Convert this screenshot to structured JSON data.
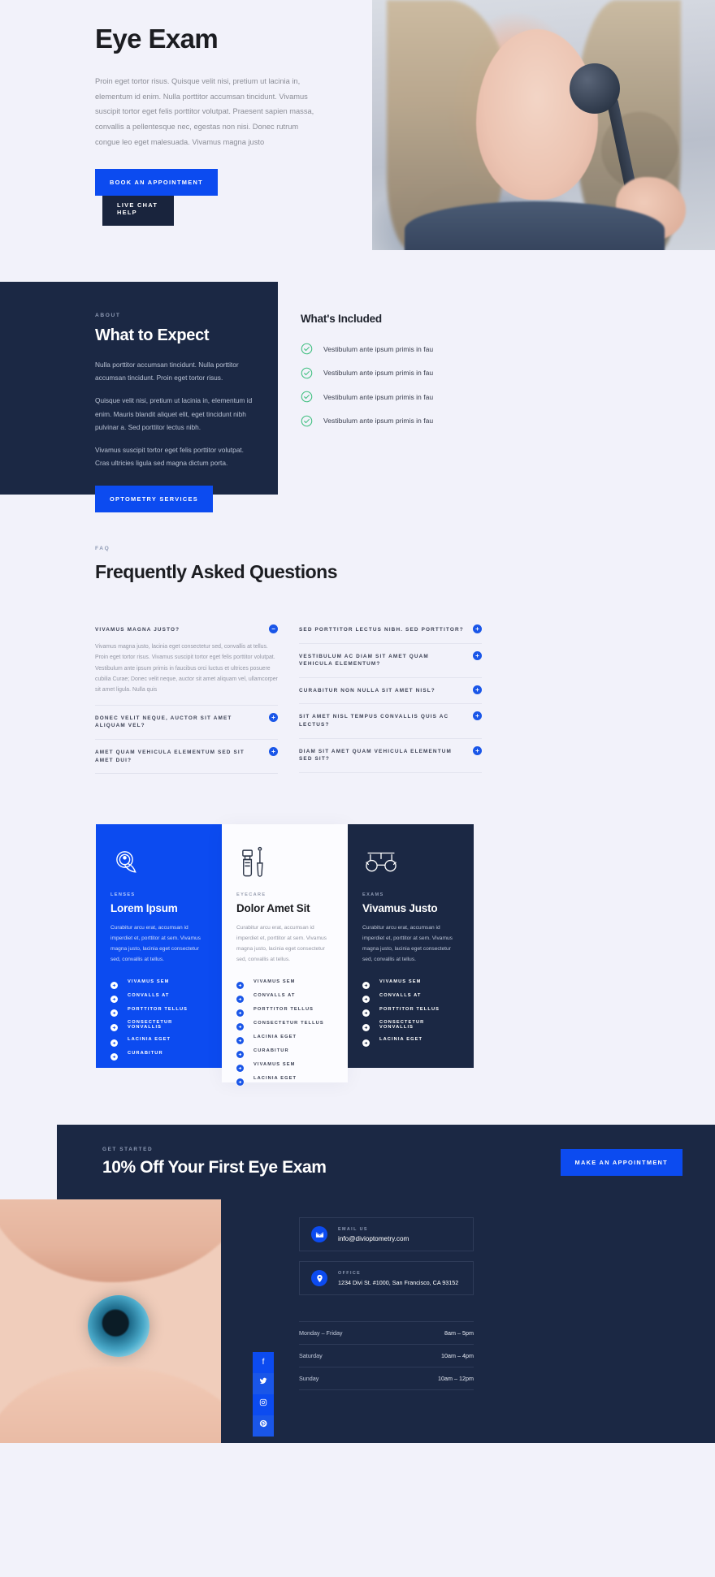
{
  "hero": {
    "title": "Eye Exam",
    "paragraph": "Proin eget tortor risus. Quisque velit nisi, pretium ut lacinia in, elementum id enim. Nulla porttitor accumsan tincidunt. Vivamus suscipit tortor eget felis porttitor volutpat. Praesent sapien massa, convallis a pellentesque nec, egestas non nisi. Donec rutrum congue leo eget malesuada. Vivamus magna justo",
    "primary_button": "BOOK AN APPOINTMENT",
    "secondary_button": "LIVE CHAT HELP"
  },
  "about": {
    "eyebrow": "ABOUT",
    "title": "What to Expect",
    "paragraphs": [
      "Nulla porttitor accumsan tincidunt. Nulla porttitor accumsan tincidunt. Proin eget tortor risus.",
      "Quisque velit nisi, pretium ut lacinia in, elementum id enim. Mauris blandit aliquet elit, eget tincidunt nibh pulvinar a. Sed porttitor lectus nibh.",
      "Vivamus suscipit tortor eget felis porttitor volutpat. Cras ultricies ligula sed magna dictum porta."
    ],
    "button": "OPTOMETRY SERVICES",
    "included_title": "What's Included",
    "included_items": [
      "Vestibulum ante ipsum primis in fau",
      "Vestibulum ante ipsum primis in fau",
      "Vestibulum ante ipsum primis in fau",
      "Vestibulum ante ipsum primis in fau"
    ],
    "check_color": "#3fbf7f"
  },
  "faq": {
    "eyebrow": "FAQ",
    "title": "Frequently Asked Questions",
    "left_column": [
      {
        "question": "VIVAMUS MAGNA JUSTO?",
        "open": true,
        "toggle": "−",
        "answer": "Vivamus magna justo, lacinia eget consectetur sed, convallis at tellus. Proin eget tortor risus. Vivamus suscipit tortor eget felis porttitor volutpat. Vestibulum ante ipsum primis in faucibus orci luctus et ultrices posuere cubilia Curae; Donec velit neque, auctor sit amet aliquam vel, ullamcorper sit amet ligula. Nulla quis"
      },
      {
        "question": "DONEC VELIT NEQUE, AUCTOR SIT AMET ALIQUAM VEL?",
        "open": false,
        "toggle": "+",
        "answer": ""
      },
      {
        "question": "AMET QUAM VEHICULA ELEMENTUM SED SIT AMET DUI?",
        "open": false,
        "toggle": "+",
        "answer": ""
      }
    ],
    "right_column": [
      {
        "question": "SED PORTTITOR LECTUS NIBH. SED PORTTITOR?",
        "open": false,
        "toggle": "+",
        "answer": ""
      },
      {
        "question": "VESTIBULUM AC DIAM SIT AMET QUAM VEHICULA ELEMENTUM?",
        "open": false,
        "toggle": "+",
        "answer": ""
      },
      {
        "question": "CURABITUR NON NULLA SIT AMET NISL?",
        "open": false,
        "toggle": "+",
        "answer": ""
      },
      {
        "question": "SIT AMET NISL TEMPUS CONVALLIS QUIS AC LECTUS?",
        "open": false,
        "toggle": "+",
        "answer": ""
      },
      {
        "question": "DIAM SIT AMET QUAM VEHICULA ELEMENTUM SED SIT?",
        "open": false,
        "toggle": "+",
        "answer": ""
      }
    ]
  },
  "cards": [
    {
      "icon": "contact-lens-icon",
      "eyebrow": "LENSES",
      "title": "Lorem Ipsum",
      "text": "Curabitur arcu erat, accumsan id imperdiet et, porttitor at sem. Vivamus magna justo, lacinia eget consectetur sed, convallis at tellus.",
      "features": [
        "VIVAMUS SEM",
        "CONVALLS AT",
        "PORTTITOR TELLUS",
        "CONSECTETUR VONVALLIS",
        "LACINIA EGET",
        "CURABITUR"
      ]
    },
    {
      "icon": "eye-drops-icon",
      "eyebrow": "EYECARE",
      "title": "Dolor Amet Sit",
      "text": "Curabitur arcu erat, accumsan id imperdiet et, porttitor at sem. Vivamus magna justo, lacinia eget consectetur sed, convallis at tellus.",
      "features": [
        "VIVAMUS SEM",
        "CONVALLS AT",
        "PORTTITOR TELLUS",
        "CONSECTETUR TELLUS",
        "LACINIA EGET",
        "CURABITUR",
        "VIVAMUS SEM",
        "LACINIA EGET"
      ]
    },
    {
      "icon": "glasses-icon",
      "eyebrow": "EXAMS",
      "title": "Vivamus Justo",
      "text": "Curabitur arcu erat, accumsan id imperdiet et, porttitor at sem. Vivamus magna justo, lacinia eget consectetur sed, convallis at tellus.",
      "features": [
        "VIVAMUS SEM",
        "CONVALLS AT",
        "PORTTITOR TELLUS",
        "CONSECTETUR VONVALLIS",
        "LACINIA EGET"
      ]
    }
  ],
  "cta": {
    "eyebrow": "GET STARTED",
    "title": "10% Off Your First Eye Exam",
    "button": "MAKE AN APPOINTMENT"
  },
  "footer": {
    "email_label": "EMAIL US",
    "email_value": "info@divioptometry.com",
    "office_label": "OFFICE",
    "office_value": "1234 Divi St. #1000, San Francisco, CA 93152",
    "hours": [
      {
        "day": "Monday – Friday",
        "time": "8am – 5pm"
      },
      {
        "day": "Saturday",
        "time": "10am – 4pm"
      },
      {
        "day": "Sunday",
        "time": "10am – 12pm"
      }
    ],
    "social": [
      {
        "name": "facebook-icon",
        "glyph": "f"
      },
      {
        "name": "twitter-icon",
        "glyph": "ᴛ"
      },
      {
        "name": "instagram-icon",
        "glyph": "▣"
      },
      {
        "name": "pinterest-icon",
        "glyph": "ᴘ"
      }
    ]
  },
  "colors": {
    "accent_blue": "#0c4bf0",
    "dark_navy": "#1b2844",
    "page_bg": "#f2f2fa",
    "green": "#3fbf7f"
  }
}
